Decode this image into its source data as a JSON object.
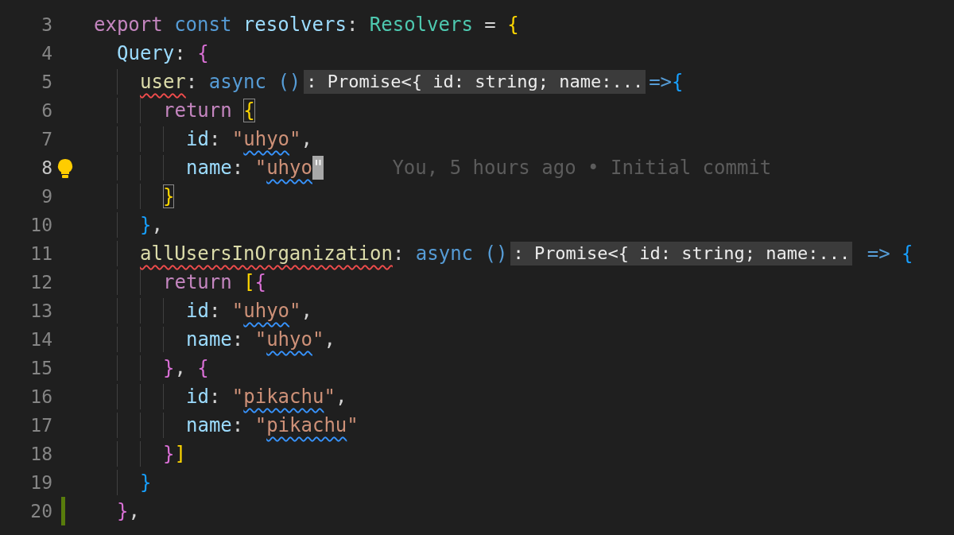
{
  "editor": {
    "lines": [
      {
        "number": "3",
        "active": false,
        "tokens": [
          {
            "text": "export",
            "kind": "keyword"
          },
          {
            "text": " const ",
            "kind": "storage"
          },
          {
            "text": "resolvers",
            "kind": "variable"
          },
          {
            "text": ": ",
            "kind": "punct"
          },
          {
            "text": "Resolvers",
            "kind": "type"
          },
          {
            "text": " = ",
            "kind": "punct"
          },
          {
            "text": "{",
            "kind": "bracket",
            "color": "#ffd700"
          }
        ],
        "children": [
          {
            "number": "4",
            "active": false,
            "tokens": [
              {
                "text": "Query",
                "kind": "property"
              },
              {
                "text": ": ",
                "kind": "punct"
              },
              {
                "text": "{",
                "kind": "bracket",
                "color": "#da70d6"
              }
            ],
            "children": [
              {
                "number": "5",
                "active": false,
                "tokens": [
                  {
                    "text": "user",
                    "kind": "function",
                    "error": true
                  },
                  {
                    "text": ": ",
                    "kind": "punct"
                  },
                  {
                    "text": "async ()",
                    "kind": "storage"
                  },
                  {
                    "text": ": Promise<{ id: string; name:...",
                    "kind": "hint"
                  },
                  {
                    "text": "=>",
                    "kind": "storage"
                  },
                  {
                    "text": "{",
                    "kind": "bracket",
                    "color": "#179fff"
                  }
                ],
                "children": [
                  {
                    "number": "6",
                    "active": false,
                    "tokens": [
                      {
                        "text": "return ",
                        "kind": "keyword"
                      },
                      {
                        "text": "{",
                        "kind": "bracket",
                        "color": "#ffd700",
                        "matched": true
                      }
                    ],
                    "children": [
                      {
                        "number": "7",
                        "active": false,
                        "tokens": [
                          {
                            "text": "id",
                            "kind": "property"
                          },
                          {
                            "text": ": ",
                            "kind": "punct"
                          },
                          {
                            "text": "\"",
                            "kind": "string"
                          },
                          {
                            "text": "uhyo",
                            "kind": "string",
                            "warning": true
                          },
                          {
                            "text": "\"",
                            "kind": "string"
                          },
                          {
                            "text": ",",
                            "kind": "punct"
                          }
                        ]
                      },
                      {
                        "number": "8",
                        "active": true,
                        "lightbulb": true,
                        "tokens": [
                          {
                            "text": "name",
                            "kind": "property"
                          },
                          {
                            "text": ": ",
                            "kind": "punct"
                          },
                          {
                            "text": "\"",
                            "kind": "string"
                          },
                          {
                            "text": "uhyo",
                            "kind": "string",
                            "warning": true
                          },
                          {
                            "text": "\"",
                            "kind": "string",
                            "cursor": true
                          },
                          {
                            "text": "You, 5 hours ago • Initial commit",
                            "kind": "blame"
                          }
                        ]
                      }
                    ]
                  },
                  {
                    "number": "9",
                    "active": false,
                    "tokens": [
                      {
                        "text": "}",
                        "kind": "bracket",
                        "color": "#ffd700",
                        "matched": true
                      }
                    ]
                  }
                ]
              },
              {
                "number": "10",
                "active": false,
                "tokens": [
                  {
                    "text": "}",
                    "kind": "bracket",
                    "color": "#179fff"
                  },
                  {
                    "text": ",",
                    "kind": "punct"
                  }
                ]
              },
              {
                "number": "11",
                "active": false,
                "tokens": [
                  {
                    "text": "allUsersInOrganization",
                    "kind": "function",
                    "error": true
                  },
                  {
                    "text": ": ",
                    "kind": "punct"
                  },
                  {
                    "text": "async ()",
                    "kind": "storage"
                  },
                  {
                    "text": ": Promise<{ id: string; name:...",
                    "kind": "hint"
                  },
                  {
                    "text": " => ",
                    "kind": "storage"
                  },
                  {
                    "text": "{",
                    "kind": "bracket",
                    "color": "#179fff"
                  }
                ],
                "children": [
                  {
                    "number": "12",
                    "active": false,
                    "tokens": [
                      {
                        "text": "return ",
                        "kind": "keyword"
                      },
                      {
                        "text": "[",
                        "kind": "bracket",
                        "color": "#ffd700"
                      },
                      {
                        "text": "{",
                        "kind": "bracket",
                        "color": "#da70d6"
                      }
                    ],
                    "children": [
                      {
                        "number": "13",
                        "active": false,
                        "tokens": [
                          {
                            "text": "id",
                            "kind": "property"
                          },
                          {
                            "text": ": ",
                            "kind": "punct"
                          },
                          {
                            "text": "\"",
                            "kind": "string"
                          },
                          {
                            "text": "uhyo",
                            "kind": "string",
                            "warning": true
                          },
                          {
                            "text": "\"",
                            "kind": "string"
                          },
                          {
                            "text": ",",
                            "kind": "punct"
                          }
                        ]
                      },
                      {
                        "number": "14",
                        "active": false,
                        "tokens": [
                          {
                            "text": "name",
                            "kind": "property"
                          },
                          {
                            "text": ": ",
                            "kind": "punct"
                          },
                          {
                            "text": "\"",
                            "kind": "string"
                          },
                          {
                            "text": "uhyo",
                            "kind": "string",
                            "warning": true
                          },
                          {
                            "text": "\"",
                            "kind": "string"
                          },
                          {
                            "text": ",",
                            "kind": "punct"
                          }
                        ]
                      }
                    ]
                  },
                  {
                    "number": "15",
                    "active": false,
                    "tokens": [
                      {
                        "text": "}",
                        "kind": "bracket",
                        "color": "#da70d6"
                      },
                      {
                        "text": ", ",
                        "kind": "punct"
                      },
                      {
                        "text": "{",
                        "kind": "bracket",
                        "color": "#da70d6"
                      }
                    ],
                    "children": [
                      {
                        "number": "16",
                        "active": false,
                        "tokens": [
                          {
                            "text": "id",
                            "kind": "property"
                          },
                          {
                            "text": ": ",
                            "kind": "punct"
                          },
                          {
                            "text": "\"",
                            "kind": "string"
                          },
                          {
                            "text": "pikachu",
                            "kind": "string",
                            "warning": true
                          },
                          {
                            "text": "\"",
                            "kind": "string"
                          },
                          {
                            "text": ",",
                            "kind": "punct"
                          }
                        ]
                      },
                      {
                        "number": "17",
                        "active": false,
                        "tokens": [
                          {
                            "text": "name",
                            "kind": "property"
                          },
                          {
                            "text": ": ",
                            "kind": "punct"
                          },
                          {
                            "text": "\"",
                            "kind": "string"
                          },
                          {
                            "text": "pikachu",
                            "kind": "string",
                            "warning": true
                          },
                          {
                            "text": "\"",
                            "kind": "string"
                          }
                        ]
                      }
                    ]
                  },
                  {
                    "number": "18",
                    "active": false,
                    "tokens": [
                      {
                        "text": "}",
                        "kind": "bracket",
                        "color": "#da70d6"
                      },
                      {
                        "text": "]",
                        "kind": "bracket",
                        "color": "#ffd700"
                      }
                    ]
                  }
                ]
              },
              {
                "number": "19",
                "active": false,
                "tokens": [
                  {
                    "text": "}",
                    "kind": "bracket",
                    "color": "#179fff"
                  }
                ]
              }
            ]
          },
          {
            "number": "20",
            "active": false,
            "git_change": true,
            "tokens": [
              {
                "text": "}",
                "kind": "bracket",
                "color": "#da70d6"
              },
              {
                "text": ",",
                "kind": "punct"
              }
            ]
          }
        ]
      }
    ]
  }
}
